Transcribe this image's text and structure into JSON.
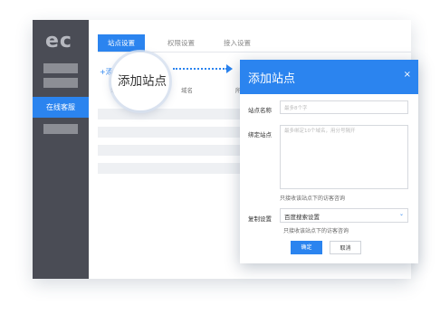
{
  "sidebar": {
    "logo": "ec",
    "active_item": "在线客服"
  },
  "tabs": [
    "站点设置",
    "权限设置",
    "接入设置"
  ],
  "add_link": "+添",
  "table": {
    "headers": [
      "站",
      "域名",
      "所"
    ]
  },
  "magnifier": {
    "text": "添加站点"
  },
  "dialog": {
    "title": "添加站点",
    "close": "×",
    "site_name_label": "站点名称",
    "site_name_placeholder": "最多8个字",
    "bind_label": "绑定站点",
    "bind_placeholder": "最多绑定10个域名，用分号隔开",
    "bind_hint": "只接收该站点下的访客咨询",
    "copy_label": "复制设置",
    "copy_value": "百度搜索设置",
    "copy_hint": "只接收该站点下的访客咨询",
    "confirm": "确定",
    "cancel": "取消"
  },
  "colors": {
    "accent": "#2b84ef",
    "sidebar": "#4a4c55"
  }
}
